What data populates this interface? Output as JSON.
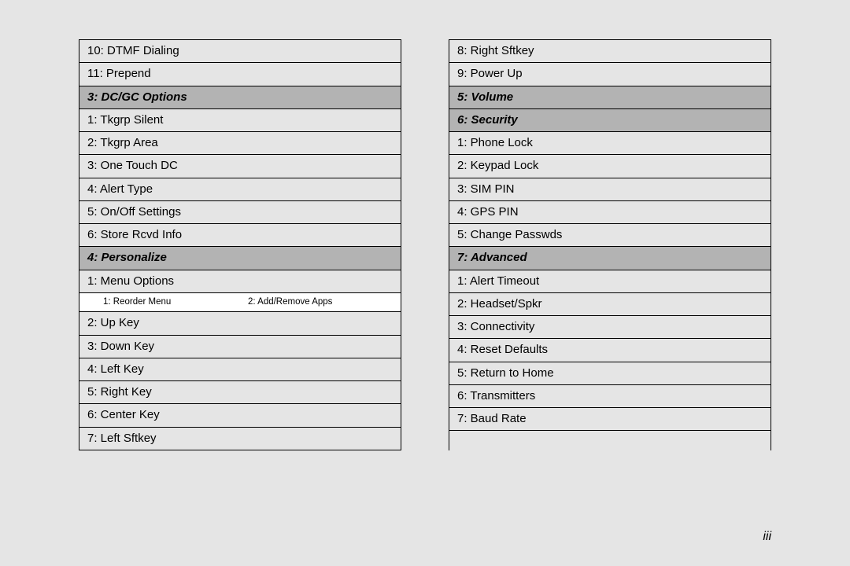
{
  "left": {
    "top": [
      "10: DTMF Dialing",
      "11: Prepend"
    ],
    "h1": "3: DC/GC Options",
    "s1": [
      "1: Tkgrp Silent",
      "2: Tkgrp Area",
      "3: One Touch DC",
      "4: Alert Type",
      "5: On/Off Settings",
      "6: Store Rcvd Info"
    ],
    "h2": "4: Personalize",
    "s2a": "1: Menu Options",
    "sub": {
      "a": "1: Reorder Menu",
      "b": "2: Add/Remove Apps"
    },
    "s2b": [
      "2: Up Key",
      "3: Down Key",
      "4: Left Key",
      "5: Right Key",
      "6: Center Key",
      "7: Left Sftkey"
    ]
  },
  "right": {
    "top": [
      "8: Right Sftkey",
      "9: Power Up"
    ],
    "h1": "5: Volume",
    "h2": "6: Security",
    "s2": [
      "1: Phone Lock",
      "2: Keypad Lock",
      "3: SIM PIN",
      "4: GPS PIN",
      "5: Change Passwds"
    ],
    "h3": "7: Advanced",
    "s3": [
      "1: Alert Timeout",
      "2: Headset/Spkr",
      "3: Connectivity",
      "4: Reset Defaults",
      "5: Return to Home",
      "6: Transmitters",
      "7: Baud Rate"
    ]
  },
  "page": "iii"
}
